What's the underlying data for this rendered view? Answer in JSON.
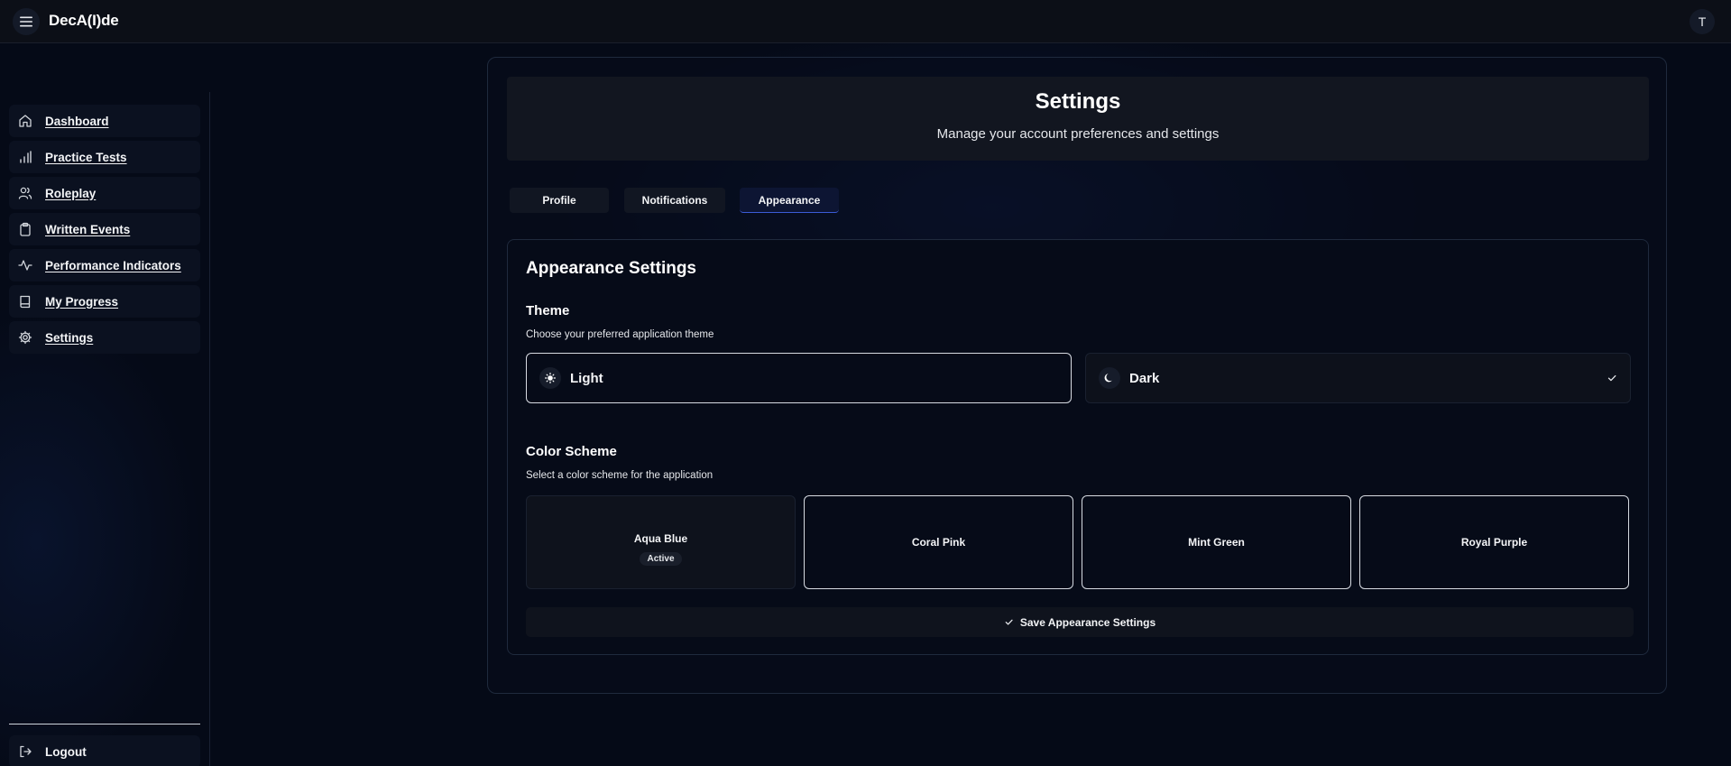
{
  "app": {
    "brand": "DecA(I)de",
    "user_initial": "T"
  },
  "sidebar": {
    "items": [
      {
        "label": "Dashboard",
        "icon": "home-icon"
      },
      {
        "label": "Practice Tests",
        "icon": "bar-chart-icon"
      },
      {
        "label": "Roleplay",
        "icon": "users-icon"
      },
      {
        "label": "Written Events",
        "icon": "clipboard-icon"
      },
      {
        "label": "Performance Indicators",
        "icon": "activity-icon"
      },
      {
        "label": "My Progress",
        "icon": "book-icon"
      },
      {
        "label": "Settings",
        "icon": "gear-icon"
      }
    ],
    "logout_label": "Logout"
  },
  "header": {
    "title": "Settings",
    "subtitle": "Manage your account preferences and settings"
  },
  "tabs": [
    {
      "label": "Profile",
      "active": false
    },
    {
      "label": "Notifications",
      "active": false
    },
    {
      "label": "Appearance",
      "active": true
    }
  ],
  "appearance": {
    "title": "Appearance Settings",
    "theme": {
      "title": "Theme",
      "description": "Choose your preferred application theme",
      "options": [
        {
          "label": "Light",
          "icon": "sun-icon",
          "selected": false
        },
        {
          "label": "Dark",
          "icon": "moon-icon",
          "selected": true
        }
      ]
    },
    "color_scheme": {
      "title": "Color Scheme",
      "description": "Select a color scheme for the application",
      "options": [
        {
          "label": "Aqua Blue",
          "active": true
        },
        {
          "label": "Coral Pink",
          "active": false
        },
        {
          "label": "Mint Green",
          "active": false
        },
        {
          "label": "Royal Purple",
          "active": false
        }
      ],
      "active_badge": "Active"
    },
    "save_label": "Save Appearance Settings"
  },
  "colors": {
    "background": "#050a17",
    "accent": "#3b5bd6",
    "surface": "#121620"
  }
}
